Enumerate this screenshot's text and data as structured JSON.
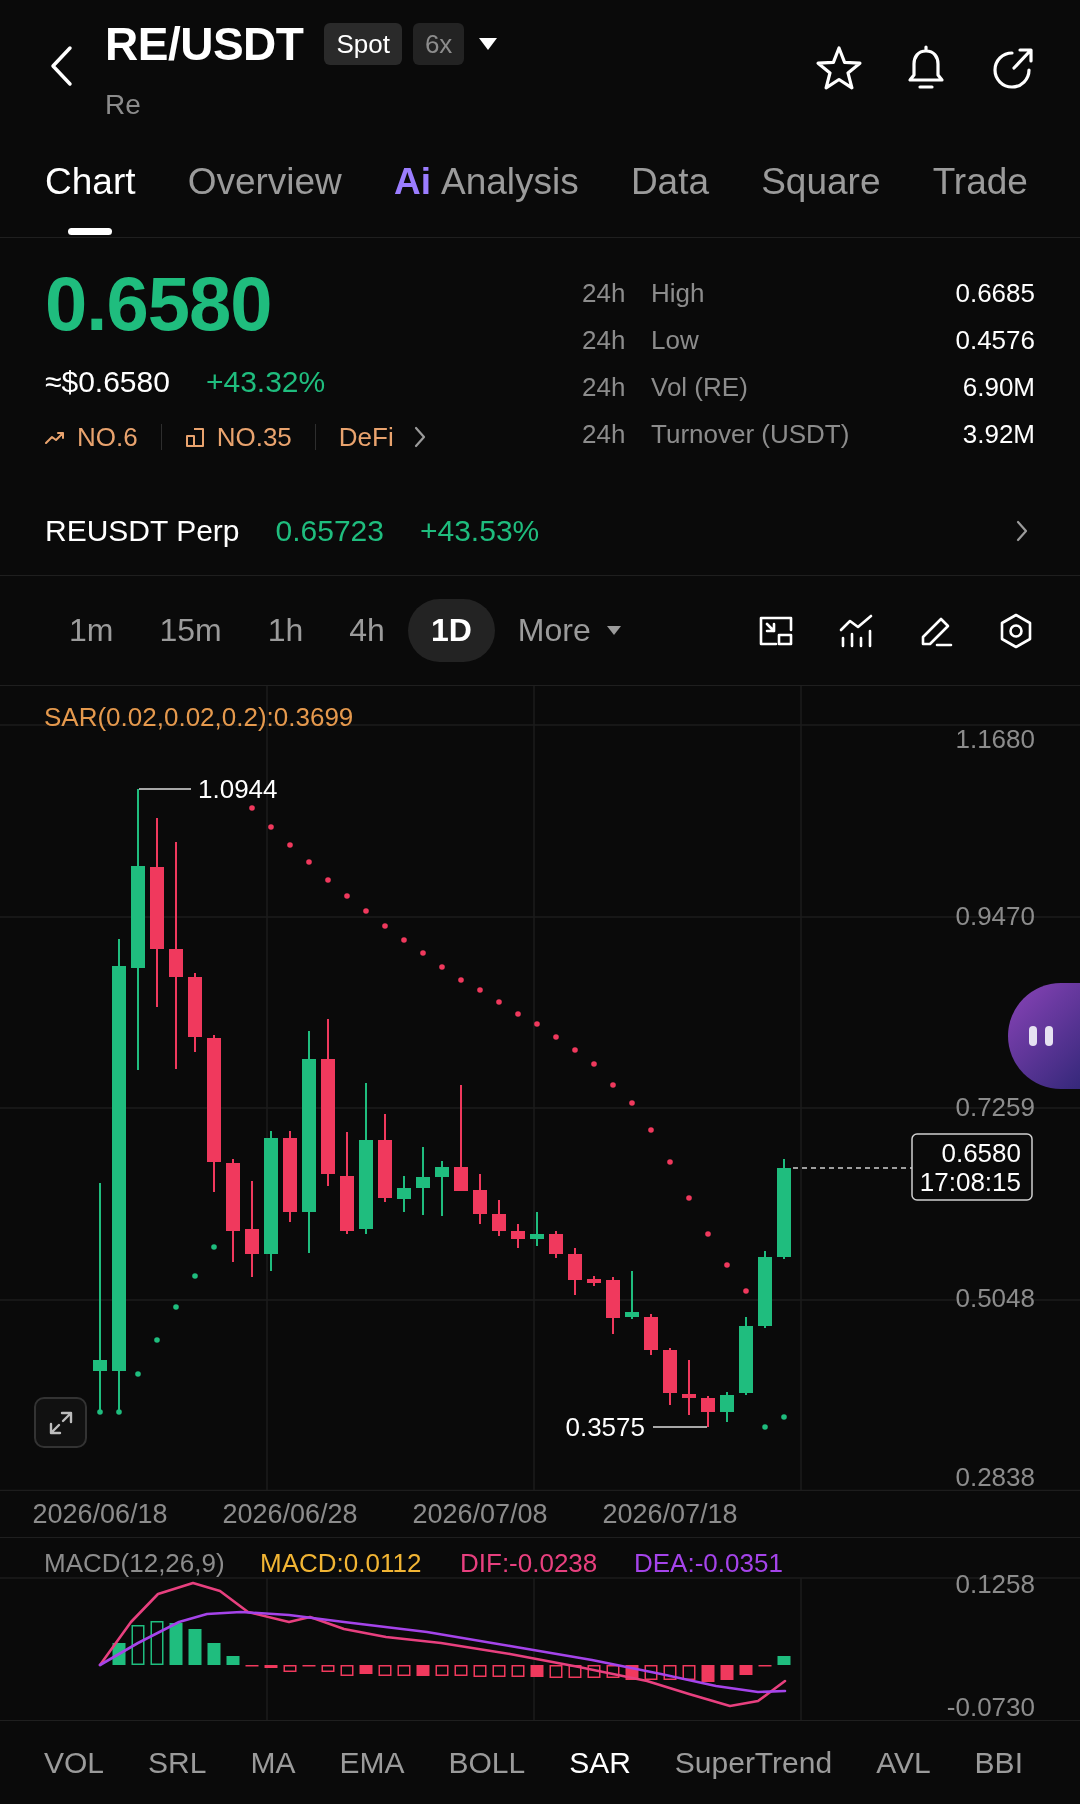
{
  "header": {
    "pair": "RE/USDT",
    "badges": [
      {
        "label": "Spot",
        "active": true
      },
      {
        "label": "6x",
        "active": false
      }
    ],
    "subtitle": "Re"
  },
  "tabs": [
    {
      "label": "Chart",
      "selected": true
    },
    {
      "label": "Overview",
      "selected": false
    },
    {
      "label": "Analysis",
      "badge": "Ai",
      "selected": false
    },
    {
      "label": "Data",
      "selected": false
    },
    {
      "label": "Square",
      "selected": false
    },
    {
      "label": "Trade",
      "selected": false
    }
  ],
  "price": {
    "last": "0.6580",
    "fiat": "≈$0.6580",
    "change": "+43.32%"
  },
  "tags": [
    {
      "kind": "trending",
      "label": "NO.6"
    },
    {
      "kind": "ranking",
      "label": "NO.35"
    },
    {
      "kind": "sector",
      "label": "DeFi"
    }
  ],
  "stats": [
    {
      "period": "24h",
      "label": "High",
      "value": "0.6685"
    },
    {
      "period": "24h",
      "label": "Low",
      "value": "0.4576"
    },
    {
      "period": "24h",
      "label": "Vol (RE)",
      "value": "6.90M"
    },
    {
      "period": "24h",
      "label": "Turnover (USDT)",
      "value": "3.92M"
    }
  ],
  "perpetual": {
    "name": "REUSDT Perp",
    "price": "0.65723",
    "change": "+43.53%"
  },
  "intervals": [
    {
      "label": "1m",
      "kind": "interval",
      "selected": false
    },
    {
      "label": "15m",
      "kind": "interval",
      "selected": false
    },
    {
      "label": "1h",
      "kind": "interval",
      "selected": false
    },
    {
      "label": "4h",
      "kind": "interval",
      "selected": false
    },
    {
      "label": "1D",
      "kind": "interval",
      "selected": true
    },
    {
      "label": "More",
      "kind": "menu",
      "selected": false
    }
  ],
  "chart": {
    "indicator": "SAR(0.02,0.02,0.2):0.3699",
    "y_ticks": [
      "1.1680",
      "0.9470",
      "0.7259",
      "0.5048",
      "0.2838"
    ],
    "high_marker": "1.0944",
    "low_marker": "0.3575",
    "last_price": "0.6580",
    "countdown": "17:08:15",
    "dates": [
      "2026/06/18",
      "2026/06/28",
      "2026/07/08",
      "2026/07/18"
    ]
  },
  "macd": {
    "legend": [
      {
        "text": "MACD(12,26,9)",
        "color": "#8c8c8c"
      },
      {
        "text": "MACD:0.0112",
        "color": "#f2b534"
      },
      {
        "text": "DIF:-0.0238",
        "color": "#e8407f"
      },
      {
        "text": "DEA:-0.0351",
        "color": "#a544ea"
      }
    ],
    "y_ticks": [
      "0.1258",
      "-0.0730"
    ]
  },
  "indicators": [
    {
      "label": "VOL",
      "selected": false
    },
    {
      "label": "SRL",
      "selected": false
    },
    {
      "label": "MA",
      "selected": false
    },
    {
      "label": "EMA",
      "selected": false
    },
    {
      "label": "BOLL",
      "selected": false
    },
    {
      "label": "SAR",
      "selected": true
    },
    {
      "label": "SuperTrend",
      "selected": false
    },
    {
      "label": "AVL",
      "selected": false
    },
    {
      "label": "BBI",
      "selected": false
    }
  ]
}
